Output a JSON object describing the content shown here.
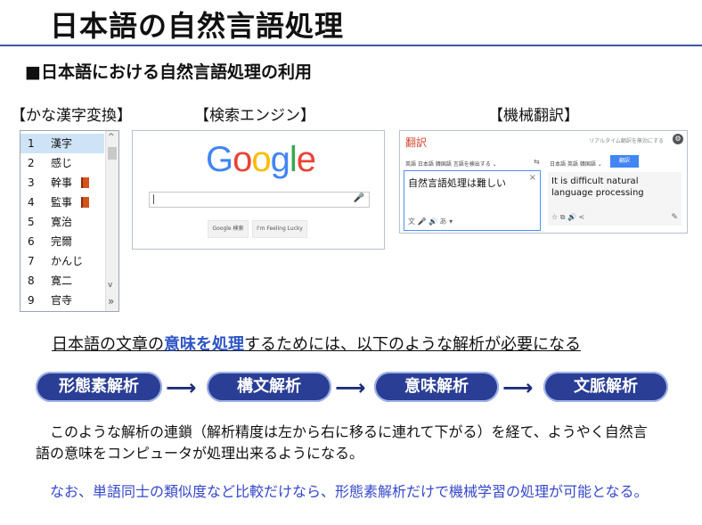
{
  "title": "日本語の自然言語処理",
  "subtitle": "■日本語における自然言語処理の利用",
  "sections": {
    "kana": "【かな漢字変換】",
    "search": "【検索エンジン】",
    "mt": "【機械翻訳】"
  },
  "ime": {
    "candidates": [
      {
        "num": "1",
        "word": "漢字"
      },
      {
        "num": "2",
        "word": "感じ"
      },
      {
        "num": "3",
        "word": "幹事"
      },
      {
        "num": "4",
        "word": "監事"
      },
      {
        "num": "5",
        "word": "寛治"
      },
      {
        "num": "6",
        "word": "完爾"
      },
      {
        "num": "7",
        "word": "かんじ"
      },
      {
        "num": "8",
        "word": "寛二"
      },
      {
        "num": "9",
        "word": "官寺"
      }
    ],
    "scroll_up": "^",
    "scroll_down": "v",
    "expand": "»"
  },
  "google": {
    "logo_letters": [
      {
        "ch": "G",
        "color": "#4285F4"
      },
      {
        "ch": "o",
        "color": "#EA4335"
      },
      {
        "ch": "o",
        "color": "#FBBC05"
      },
      {
        "ch": "g",
        "color": "#4285F4"
      },
      {
        "ch": "l",
        "color": "#34A853"
      },
      {
        "ch": "e",
        "color": "#EA4335"
      }
    ],
    "search_button": "Google 検索",
    "lucky_button": "I'm Feeling Lucky",
    "mic": "🎤"
  },
  "translate": {
    "logo": "翻訳",
    "realtime": "リアルタイム翻訳を無効にする",
    "gear": "⚙",
    "source_langs": "英語  日本語  韓国語  言語を検出する  ⌄",
    "swap": "⇆",
    "target_langs": "日本語  英語  韓国語  ⌄",
    "translate_button": "翻訳",
    "source_text": "自然言語処理は難しい",
    "close": "×",
    "source_icons": "文  🎤  🔊  あ ▾",
    "output_text": "It is difficult natural language processing",
    "output_icons": "☆  ⧉  🔊  <",
    "pencil": "✎"
  },
  "statement": {
    "before": "日本語の文章の",
    "highlight": "意味を処理",
    "after": "するためには、以下のような解析が必要になる"
  },
  "flow": [
    "形態素解析",
    "構文解析",
    "意味解析",
    "文脈解析"
  ],
  "flow_arrow": "⟶",
  "paragraph1": "　このような解析の連鎖（解析精度は左から右に移るに連れて下がる）を経て、ようやく自然言語の意味をコンピュータが処理出来るようになる。",
  "paragraph2": "　なお、単語同士の類似度など比較だけなら、形態素解析だけで機械学習の処理が可能となる。"
}
